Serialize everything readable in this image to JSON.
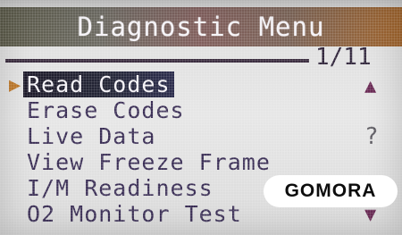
{
  "title": "Diagnostic Menu",
  "page_indicator": "1/11",
  "menu": {
    "items": [
      {
        "label": "Read Codes",
        "selected": true
      },
      {
        "label": "Erase Codes"
      },
      {
        "label": "Live Data"
      },
      {
        "label": "View Freeze Frame"
      },
      {
        "label": "I/M Readiness"
      },
      {
        "label": "O2 Monitor Test"
      }
    ]
  },
  "icons": {
    "cursor": "cursor-arrow-icon",
    "scroll_up": "scroll-up-icon",
    "help": "help-icon",
    "scroll_down": "scroll-down-icon"
  },
  "watermark": {
    "text": "GOMORA"
  },
  "colors": {
    "title_bar_left": "#5b5a49",
    "title_bar_right": "#a0642c",
    "menu_text": "#3a2e55",
    "selected_bg": "#1d1a2a",
    "cursor": "#c07a2b"
  }
}
